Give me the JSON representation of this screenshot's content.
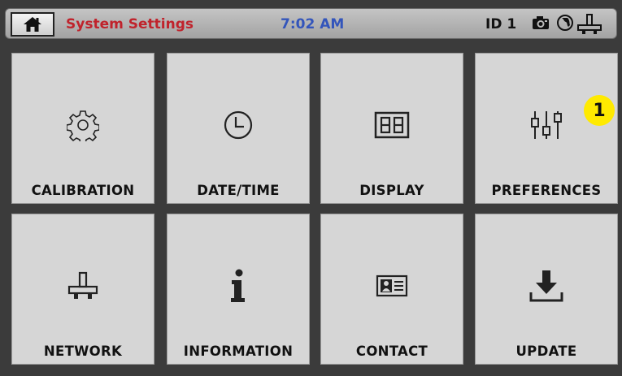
{
  "header": {
    "title": "System Settings",
    "time": "7:02 AM",
    "id_label": "ID 1",
    "title_color": "#c0232c",
    "time_color": "#3355bb",
    "icons": [
      "home-icon",
      "camera-icon",
      "globe-icon",
      "network-icon"
    ]
  },
  "tiles": [
    {
      "label": "CALIBRATION",
      "icon": "gear-icon"
    },
    {
      "label": "DATE/TIME",
      "icon": "clock-icon"
    },
    {
      "label": "DISPLAY",
      "icon": "display-icon"
    },
    {
      "label": "PREFERENCES",
      "icon": "sliders-icon"
    },
    {
      "label": "NETWORK",
      "icon": "network-icon"
    },
    {
      "label": "INFORMATION",
      "icon": "info-icon"
    },
    {
      "label": "CONTACT",
      "icon": "contact-card-icon"
    },
    {
      "label": "UPDATE",
      "icon": "download-icon"
    }
  ],
  "callout": {
    "number": "1"
  }
}
